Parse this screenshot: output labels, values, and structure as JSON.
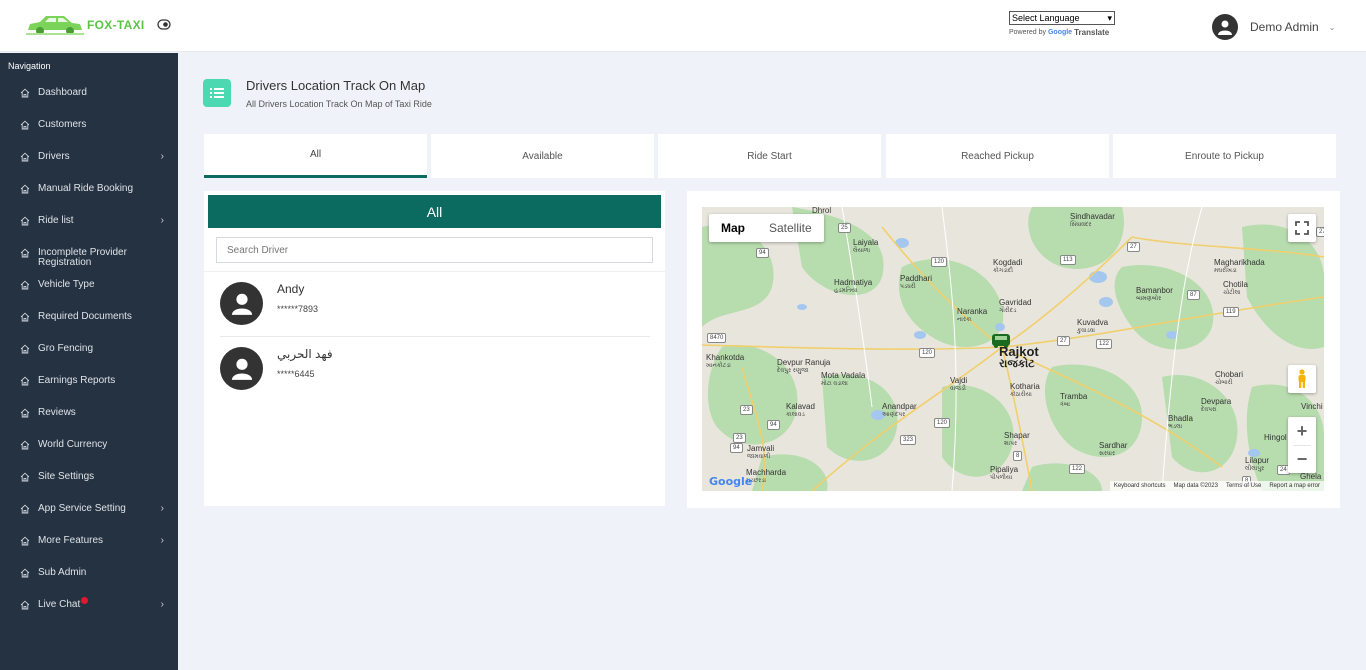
{
  "brand": {
    "name": "FOX-TAXI"
  },
  "translate": {
    "select_label": "Select Language",
    "powered_by": "Powered by",
    "google": "Google",
    "translate": "Translate"
  },
  "user": {
    "name": "Demo Admin"
  },
  "sidebar": {
    "heading": "Navigation",
    "items": [
      {
        "label": "Dashboard",
        "has_children": false
      },
      {
        "label": "Customers",
        "has_children": false
      },
      {
        "label": "Drivers",
        "has_children": true
      },
      {
        "label": "Manual Ride Booking",
        "has_children": false
      },
      {
        "label": "Ride list",
        "has_children": true
      },
      {
        "label": "Incomplete Provider Registration",
        "has_children": false
      },
      {
        "label": "Vehicle Type",
        "has_children": false
      },
      {
        "label": "Required Documents",
        "has_children": false
      },
      {
        "label": "Gro Fencing",
        "has_children": false
      },
      {
        "label": "Earnings Reports",
        "has_children": false
      },
      {
        "label": "Reviews",
        "has_children": false
      },
      {
        "label": "World Currency",
        "has_children": false
      },
      {
        "label": "Site Settings",
        "has_children": false
      },
      {
        "label": "App Service Setting",
        "has_children": true
      },
      {
        "label": "More Features",
        "has_children": true
      },
      {
        "label": "Sub Admin",
        "has_children": false
      },
      {
        "label": "Live Chat",
        "has_children": true
      }
    ]
  },
  "page": {
    "title": "Drivers Location Track On Map",
    "subtitle": "All Drivers Location Track On Map of Taxi Ride"
  },
  "tabs": [
    {
      "label": "All",
      "active": true
    },
    {
      "label": "Available",
      "active": false
    },
    {
      "label": "Ride Start",
      "active": false
    },
    {
      "label": "Reached Pickup",
      "active": false
    },
    {
      "label": "Enroute to Pickup",
      "active": false
    }
  ],
  "drivers_panel": {
    "header": "All",
    "search_placeholder": "Search Driver",
    "drivers": [
      {
        "name": "Andy",
        "phone": "******7893"
      },
      {
        "name": "فهد الحربي",
        "phone": "*****6445"
      }
    ]
  },
  "map": {
    "type_buttons": [
      "Map",
      "Satellite"
    ],
    "active_type": "Map",
    "places": [
      {
        "name": "Dhrol",
        "local": ""
      },
      {
        "name": "Sindhavadar",
        "local": "સિંધાવદર"
      },
      {
        "name": "Laiyala",
        "local": "લૈયાળા"
      },
      {
        "name": "Hadmatiya",
        "local": "હડમતિયા"
      },
      {
        "name": "Paddhari",
        "local": "પડધરી"
      },
      {
        "name": "Kogdadi",
        "local": "કોગડાદી"
      },
      {
        "name": "Gavridad",
        "local": "ગૌરીદડ"
      },
      {
        "name": "Naranka",
        "local": "નારંકા"
      },
      {
        "name": "Kuvadva",
        "local": "કુવાડવા"
      },
      {
        "name": "Bamanbor",
        "local": "બામણબોર"
      },
      {
        "name": "Magharikhada",
        "local": "મઘરીખડા"
      },
      {
        "name": "Chotila",
        "local": "ચોટીલા"
      },
      {
        "name": "Khankotda",
        "local": "ખાનકોટડા"
      },
      {
        "name": "Devpur Ranuja",
        "local": "દેવપુર રણુજા"
      },
      {
        "name": "Mota Vadala",
        "local": "મોટા વડાલા"
      },
      {
        "name": "Rajkot",
        "local": "રાજકોટ"
      },
      {
        "name": "Vajdi",
        "local": "વાજડી"
      },
      {
        "name": "Kotharia",
        "local": "કોઠારીયા"
      },
      {
        "name": "Tramba",
        "local": "ત્રંબા"
      },
      {
        "name": "Chobari",
        "local": "ચોબારી"
      },
      {
        "name": "Kalavad",
        "local": "કાલાવડ"
      },
      {
        "name": "Anandpar",
        "local": "આણંદપર"
      },
      {
        "name": "Bhadla",
        "local": "ભડલા"
      },
      {
        "name": "Devpara",
        "local": "દેવપરા"
      },
      {
        "name": "Vinchi",
        "local": ""
      },
      {
        "name": "Shapar",
        "local": "શાપર"
      },
      {
        "name": "Jamvali",
        "local": "જામવાળી"
      },
      {
        "name": "Sardhar",
        "local": "સરધાર"
      },
      {
        "name": "Hingol",
        "local": ""
      },
      {
        "name": "Lilapur",
        "local": "લીલાપુર"
      },
      {
        "name": "Machharda",
        "local": "મચ્છરડા"
      },
      {
        "name": "Pipaliya",
        "local": "પીપળીયા"
      },
      {
        "name": "Ghela",
        "local": ""
      }
    ],
    "roads": [
      "25",
      "94",
      "120",
      "113",
      "27",
      "27",
      "119",
      "87",
      "27",
      "120",
      "122",
      "8470",
      "23",
      "23",
      "94",
      "120",
      "323",
      "94",
      "8",
      "122",
      "8",
      "24"
    ],
    "footer": [
      "Keyboard shortcuts",
      "Map data ©2023",
      "Terms of Use",
      "Report a map error"
    ],
    "logo": "Google"
  },
  "colors": {
    "accent": "#0b6b60",
    "sidebar": "#243241",
    "page_icon": "#4cd8b0",
    "brand": "#5cc445",
    "badge": "#e6162d"
  }
}
